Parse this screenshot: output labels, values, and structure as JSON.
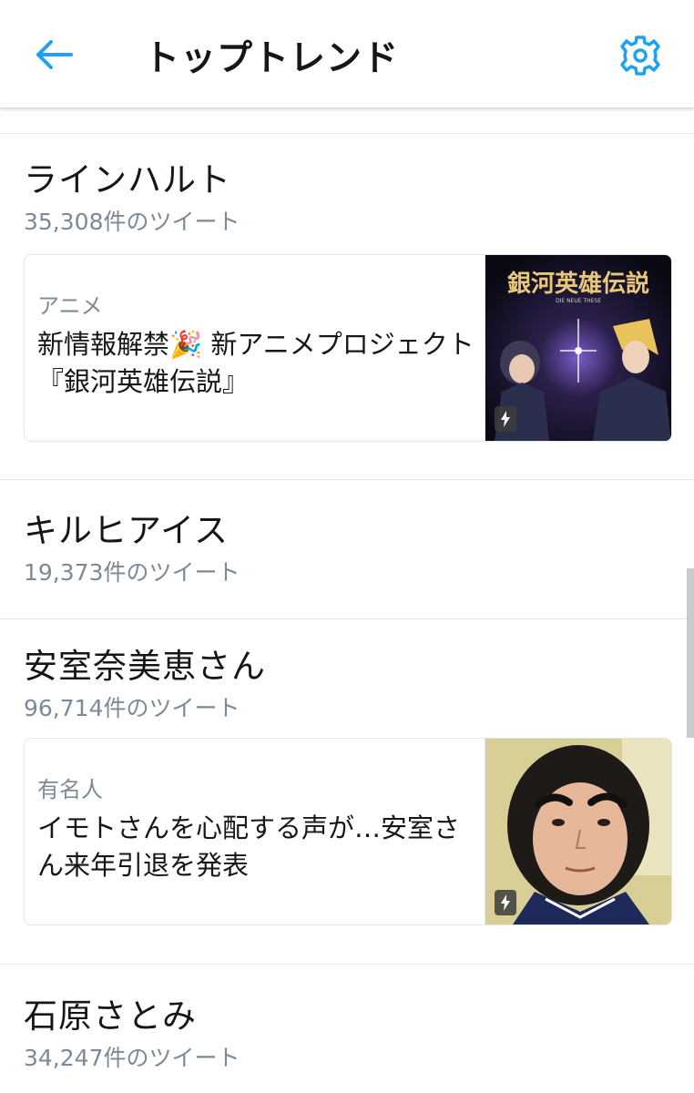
{
  "header": {
    "title": "トップトレンド",
    "accent_color": "#1da1f2"
  },
  "trends": [
    {
      "name": "ラインハルト",
      "count": "35,308件のツイート",
      "card": {
        "category": "アニメ",
        "headline": "新情報解禁🎉 新アニメプロジェクト『銀河英雄伝説』",
        "thumb_title": "銀河英雄伝説",
        "thumb_subtitle": "DIE NEUE THESE"
      }
    },
    {
      "name": "キルヒアイス",
      "count": "19,373件のツイート"
    },
    {
      "name": "安室奈美恵さん",
      "count": "96,714件のツイート",
      "card": {
        "category": "有名人",
        "headline": "イモトさんを心配する声が…安室さん来年引退を発表"
      }
    },
    {
      "name": "石原さとみ",
      "count": "34,247件のツイート"
    }
  ]
}
